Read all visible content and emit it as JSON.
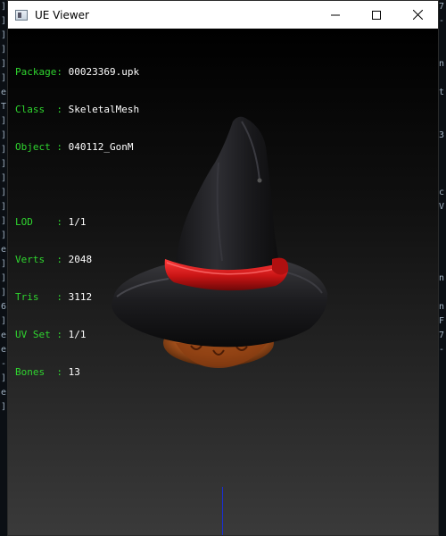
{
  "window": {
    "title": "UE Viewer",
    "controls": {
      "minimize_icon": "minimize-icon",
      "maximize_icon": "maximize-icon",
      "close_icon": "close-icon"
    }
  },
  "info": {
    "package": {
      "key": "Package:",
      "value": "00023369.upk"
    },
    "class": {
      "key": "Class  :",
      "value": "SkeletalMesh"
    },
    "object": {
      "key": "Object :",
      "value": "040112_GonM"
    },
    "lod": {
      "key": "LOD    :",
      "value": "1/1"
    },
    "verts": {
      "key": "Verts  :",
      "value": "2048"
    },
    "tris": {
      "key": "Tris   :",
      "value": "3112"
    },
    "uvset": {
      "key": "UV Set :",
      "value": "1/1"
    },
    "bones": {
      "key": "Bones  :",
      "value": "13"
    }
  },
  "background_console": {
    "left": [
      "]",
      "]",
      "]",
      "]",
      "]",
      "]",
      "e",
      "T",
      "]",
      "]",
      "]",
      "]",
      "]",
      "]",
      "]",
      "]",
      "]",
      "e",
      "]",
      "]",
      "]",
      "6",
      "]",
      "e",
      "e",
      "-",
      "]",
      "e",
      "]"
    ],
    "right": [
      "7",
      "-",
      "",
      "",
      "n",
      "",
      "t",
      "",
      "",
      "3",
      "",
      "",
      "",
      "c",
      "V",
      "",
      "",
      "",
      "",
      "n",
      "",
      "n",
      "F",
      "7",
      "-"
    ]
  },
  "colors": {
    "label_green": "#2fd52f",
    "value_white": "#ffffff",
    "axis_blue": "#1a2fd0",
    "hat_band_red": "#d01818"
  }
}
